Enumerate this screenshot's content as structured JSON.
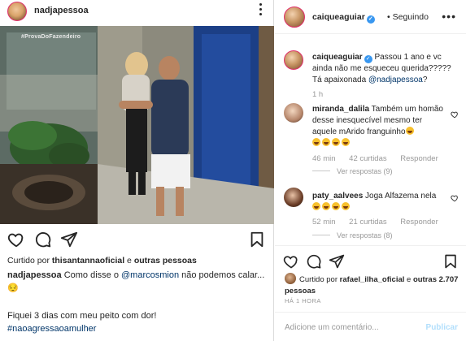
{
  "left_post": {
    "username": "nadjapessoa",
    "video_tag": "#ProvaDoFazendeiro",
    "liked_by_user": "thisantannaoficial",
    "liked_by_joiner": " e ",
    "liked_by_others": "outras pessoas",
    "liked_by_prefix": "Curtido por ",
    "caption_user": "nadjapessoa",
    "caption_text_1": " Como disse o ",
    "caption_mention": "@marcosmion",
    "caption_text_2": " não podemos calar... 😔",
    "caption_line_2": "Fiquei 3 dias com meu peito com dor!",
    "caption_hashtag": "#naoagressaoamulher"
  },
  "right_post": {
    "username": "caiqueaguiar",
    "separator": "•",
    "follow_status": "Seguindo",
    "main_comment": {
      "user": "caiqueaguiar",
      "text": " Passou 1 ano e vc ainda não me esqueceu querida????? Tá apaixonada ",
      "mention": "@nadjapessoa",
      "end": "?",
      "time": "1 h"
    },
    "comments": [
      {
        "user": "miranda_dalila",
        "text": " Também um homão desse inesquecível mesmo ter aquele mArido franguinho",
        "time": "46 min",
        "likes": "42 curtidas",
        "reply": "Responder",
        "view_replies": "Ver respostas (9)"
      },
      {
        "user": "paty_aalvees",
        "text": " Joga Alfazema nela",
        "time": "52 min",
        "likes": "21 curtidas",
        "reply": "Responder",
        "view_replies": "Ver respostas (8)"
      }
    ],
    "liked_by_prefix": "Curtido por ",
    "liked_by_user": "rafael_ilha_oficial",
    "liked_by_joiner": " e ",
    "liked_by_others": "outras 2.707 pessoas",
    "timestamp": "HÁ 1 HORA",
    "comment_placeholder": "Adicione um comentário...",
    "publish_label": "Publicar"
  },
  "colors": {
    "text": "#262626",
    "muted": "#999999",
    "link": "#003569",
    "verified": "#3897f0",
    "publish_disabled": "#b2dffc"
  }
}
